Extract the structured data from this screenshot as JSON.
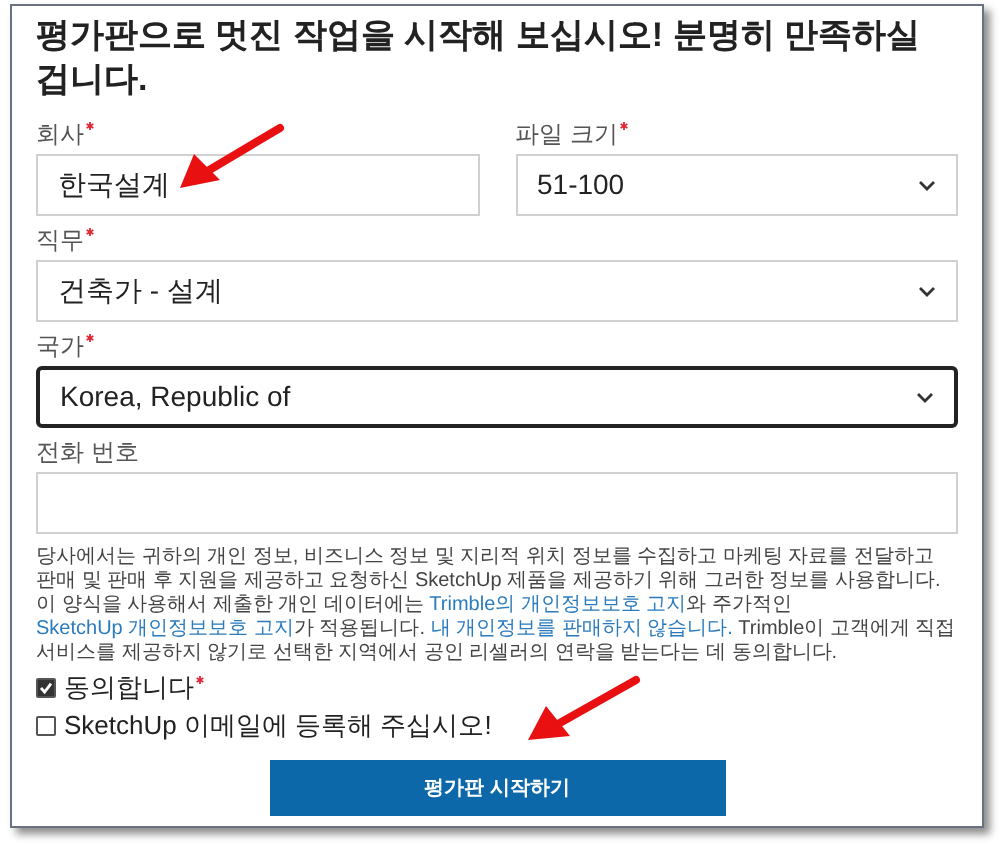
{
  "heading": "평가판으로 멋진 작업을 시작해 보십시오! 분명히 만족하실 겁니다.",
  "rows": [
    [
      {
        "kind": "input",
        "label": "회사",
        "required": true,
        "value": "한국설계",
        "focused": false
      },
      {
        "kind": "select",
        "label": "파일 크기",
        "required": true,
        "value": "51-100",
        "focused": false
      }
    ],
    [
      {
        "kind": "select",
        "label": "직무",
        "required": true,
        "value": "건축가 - 설계",
        "focused": false
      }
    ],
    [
      {
        "kind": "select",
        "label": "국가",
        "required": true,
        "value": "Korea, Republic of",
        "focused": true
      }
    ],
    [
      {
        "kind": "input",
        "label": "전화 번호",
        "required": false,
        "focused": false
      }
    ]
  ],
  "consent_text": [
    {
      "kind": "text",
      "text": "당사에서는 귀하의 개인 정보, 비즈니스 정보 및 지리적 위치 정보를 수집하고 마케팅 자료를 전달하고 판매 및 판매 후 지원을 제공하고 요청하신 SketchUp 제품을 제공하기 위해 그러한 정보를 사용합니다. 이 양식을 사용해서 제출한 개인 데이터에는 "
    },
    {
      "kind": "link",
      "text": "Trimble의 개인정보보호 고지"
    },
    {
      "kind": "text",
      "text": "와 주가적인 "
    },
    {
      "kind": "link",
      "text": "SketchUp 개인정보보호 고지"
    },
    {
      "kind": "text",
      "text": "가 적용됩니다. "
    },
    {
      "kind": "link",
      "text": "내 개인정보를 판매하지 않습니다."
    },
    {
      "kind": "text",
      "text": " Trimble이 고객에게 직접 서비스를 제공하지 않기로 선택한 지역에서 공인 리셀러의 연락을 받는다는 데 동의합니다."
    }
  ],
  "checkboxes": [
    {
      "label": "동의합니다",
      "required": true,
      "checked": true
    },
    {
      "label": "SketchUp 이메일에 등록해 주십시오!",
      "required": false,
      "checked": false
    }
  ],
  "submit_button": "평가판 시작하기"
}
